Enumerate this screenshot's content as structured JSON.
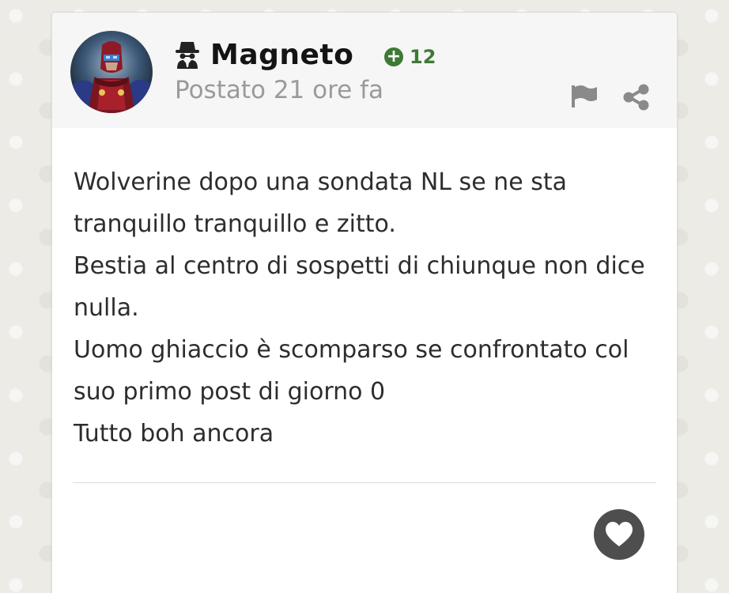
{
  "post": {
    "author": {
      "name": "Magneto",
      "reputation": "12",
      "badge_icon": "spy-icon",
      "reputation_icon": "plus-circle-icon"
    },
    "posted_label": "Postato 21 ore fa",
    "actions": {
      "report_icon": "flag-icon",
      "share_icon": "share-icon",
      "like_icon": "heart-icon"
    },
    "body_lines": [
      "Wolverine dopo una sondata NL se ne sta tranquillo tranquillo e zitto.",
      "Bestia al centro di sospetti di chiunque non dice nulla.",
      "Uomo ghiaccio è scomparso se confrontato col suo primo post di giorno 0",
      "Tutto boh ancora"
    ],
    "colors": {
      "reputation_green": "#3d7a34",
      "meta_gray": "#9a9a9a",
      "icon_gray": "#8a8a8a",
      "like_button": "#4e4e4e"
    }
  }
}
